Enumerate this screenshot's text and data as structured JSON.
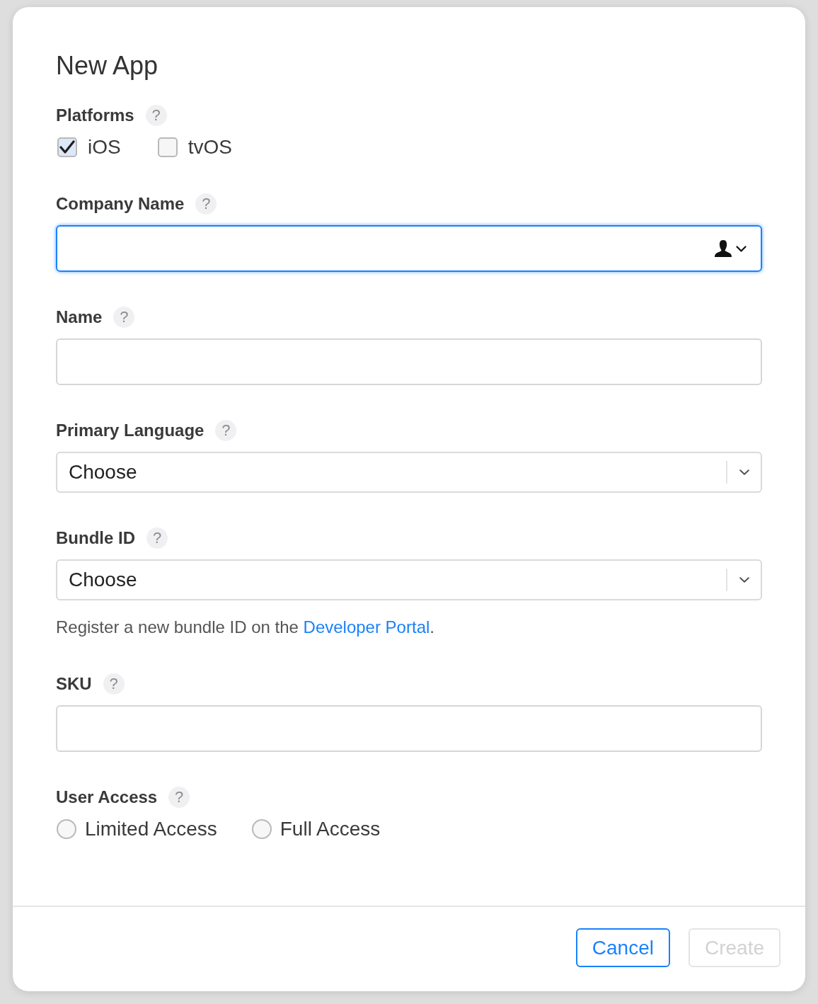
{
  "dialog": {
    "title": "New App"
  },
  "fields": [
    {
      "kind": "checkboxes",
      "label": "Platforms",
      "help": "?",
      "options": [
        {
          "label": "iOS",
          "checked": true
        },
        {
          "label": "tvOS",
          "checked": false
        }
      ]
    },
    {
      "kind": "text",
      "label": "Company Name",
      "help": "?",
      "focused": true,
      "autofill": true
    },
    {
      "kind": "text",
      "label": "Name",
      "help": "?",
      "focused": false,
      "autofill": false
    },
    {
      "kind": "select",
      "label": "Primary Language",
      "help": "?",
      "value": "Choose"
    },
    {
      "kind": "select",
      "label": "Bundle ID",
      "help": "?",
      "value": "Choose",
      "note": {
        "text": "Register a new bundle ID on the ",
        "link": "Developer Portal",
        "after": "."
      }
    },
    {
      "kind": "text",
      "label": "SKU",
      "help": "?",
      "focused": false,
      "autofill": false
    },
    {
      "kind": "radios",
      "label": "User Access",
      "help": "?",
      "options": [
        {
          "label": "Limited Access",
          "selected": false
        },
        {
          "label": "Full Access",
          "selected": false
        }
      ]
    }
  ],
  "buttons": [
    {
      "label": "Cancel",
      "disabled": false
    },
    {
      "label": "Create",
      "disabled": true
    }
  ]
}
